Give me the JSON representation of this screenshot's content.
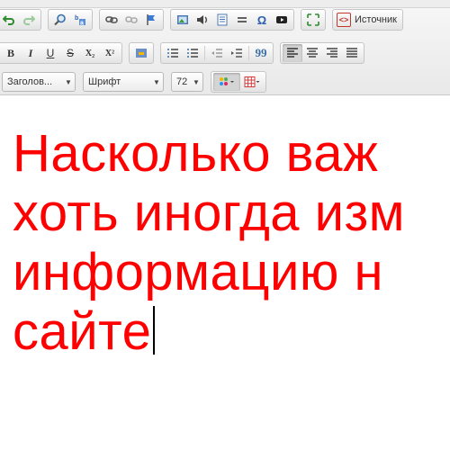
{
  "toolbar": {
    "source_label": "Источник",
    "format_combo": {
      "value": "Заголов..."
    },
    "font_combo": {
      "value": "Шрифт"
    },
    "size_combo": {
      "value": "72"
    },
    "bold": "B",
    "italic": "I",
    "underline": "U",
    "strike": "S",
    "subscript": "X₂",
    "superscript": "X²",
    "blockquote": "99",
    "special_char": "Ω",
    "text_color": "#ff0000"
  },
  "editor": {
    "lines": [
      "Насколько важ",
      "хоть иногда изм",
      "информацию н",
      "сайте"
    ]
  }
}
